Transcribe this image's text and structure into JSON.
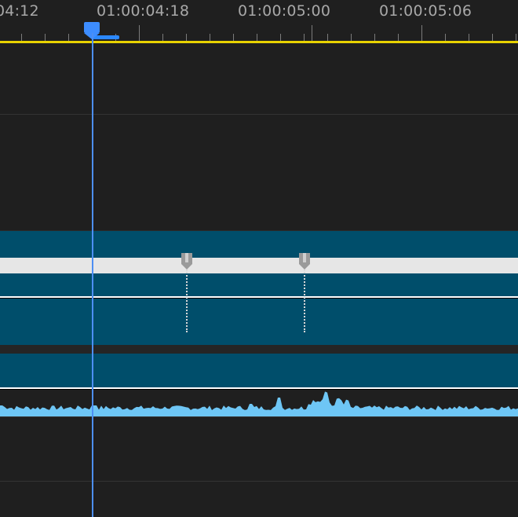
{
  "timeline": {
    "timecodes": [
      "04:12",
      "01:00:04:18",
      "01:00:05:00",
      "01:00:05:06"
    ],
    "playhead_color": "#4d8ff3",
    "work_area_color": "#e8d200",
    "clip_color": "#004e6b",
    "waveform_color": "#6ec6f5"
  }
}
